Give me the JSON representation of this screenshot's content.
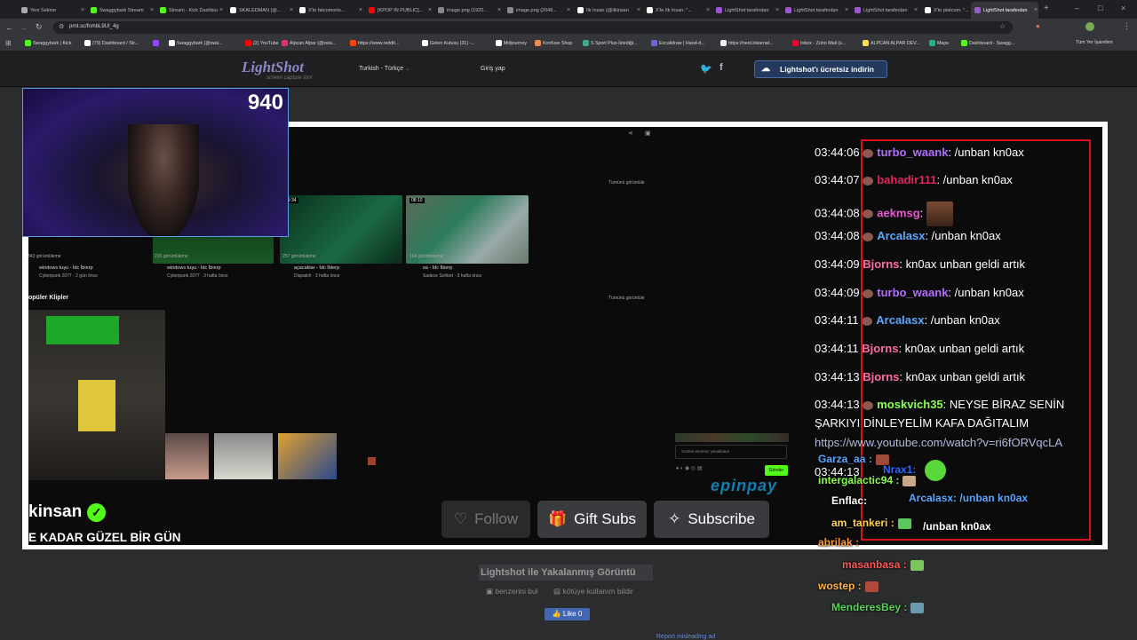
{
  "browser": {
    "tabs": [
      {
        "label": "Yeni Sekme",
        "color": "#aaaaaa"
      },
      {
        "label": "Swaggybark Stream",
        "color": "#53fc18"
      },
      {
        "label": "Stream - Kick Dashboard",
        "color": "#53fc18"
      },
      {
        "label": "SKALEDMAN (@...",
        "color": "#ffffff"
      },
      {
        "label": "X'te fatcomorto...",
        "color": "#ffffff"
      },
      {
        "label": "[KPOP IN PUBLIC]...",
        "color": "#ff0000"
      },
      {
        "label": "image.png (1920...",
        "color": "#888888"
      },
      {
        "label": "image.png (2048...",
        "color": "#888888"
      },
      {
        "label": "İlk İnsan (@ilkinsan",
        "color": "#ffffff"
      },
      {
        "label": "X'te İlk İnsan: \"...",
        "color": "#ffffff"
      },
      {
        "label": "LightShot tarafından",
        "color": "#9b59d0"
      },
      {
        "label": "LightShot tarafından",
        "color": "#9b59d0"
      },
      {
        "label": "LightShot tarafından",
        "color": "#9b59d0"
      },
      {
        "label": "X'te platcom: \"...",
        "color": "#ffffff"
      },
      {
        "label": "LightShot tarafından",
        "color": "#9b59d0"
      }
    ],
    "url": "prnt.sc/fnmbL9UI_4g",
    "bookmarks": [
      "Swaggybark | Kick",
      "(79) Dashboard / Str...",
      "",
      "Swaggybark (@swa...",
      "(2) YouTube",
      "Alpcan Alpar (@swa...",
      "https://www.reddit...",
      "Gelen Kutusu (31) -...",
      "Midjourney",
      "Konfuse Shop",
      "S Sport Plus-İstediği...",
      "Excalidraw | Hand-d...",
      "https://next.inkarnat...",
      "Inbox - Zoho Mail (s...",
      "ALPCAN ALPAR DEV...",
      "Maps",
      "Dashboard - Swagg..."
    ],
    "bookmarks_right": "Tüm Yer İşaretleri"
  },
  "lightshot": {
    "logo": "LightShot",
    "logo_sub": "screen capture tool",
    "language": "Turkish - Türkçe",
    "login": "Giriş yap",
    "download_button": "Lightshot'ı ücretsiz indirin",
    "caption": "Lightshot ile Yakalanmış Görüntü",
    "similar": "benzerini bul",
    "report": "kötüye kullanım bildir",
    "like": "Like 0",
    "misleading": "Report misleading ad"
  },
  "webcam": {
    "viewer_count": "940"
  },
  "screenshot": {
    "see_all_1": "Tümünü görüntüle",
    "see_all_2": "Tümünü görüntüle",
    "popular_clips": "opüler Klipler",
    "videos": [
      {
        "views": "343 görüntüleme",
        "title": "windows tuşu - İdc İbierp",
        "meta": "Cyberpunk 2077 · 2 gün önce"
      },
      {
        "views": "215 görüntüleme",
        "title": "windows tuşu - İdc İbierp",
        "meta": "Cyberpunk 2077 · 3 hafta önce"
      },
      {
        "views": "257 görüntüleme",
        "title": "açacaklar - İdc İbierp",
        "meta": "Dispatch · 3 hafta önce"
      },
      {
        "views": "164 görüntüleme",
        "title": "sa - İdc İbierp",
        "meta": "Sadece Sohbet · 3 hafta önce"
      }
    ],
    "thumb_duration_3": "29:34",
    "thumb_duration_4": "08:10",
    "channel_name": "kinsan",
    "stream_title": "E KADAR GÜZEL BİR GÜN",
    "follow": "Follow",
    "gift_subs": "Gift Subs",
    "subscribe": "Subscribe",
    "chat_placeholder": "Sohbet etmeniz yasaklandı",
    "sponsor": "epinpay",
    "sponsor_button": "Gönder"
  },
  "chat_messages": [
    {
      "time": "03:44:06",
      "user": "turbo_waank",
      "color": "#b36cff",
      "text": ": /unban kn0ax"
    },
    {
      "time": "03:44:07",
      "user": "bahadir111",
      "color": "#e0245e",
      "text": ": /unban kn0ax"
    },
    {
      "time": "03:44:08",
      "user": "aekmsg",
      "color": "#e85ad0",
      "text": ":"
    },
    {
      "time": "03:44:08",
      "user": "Arcalasx",
      "color": "#5aa8ff",
      "text": ": /unban kn0ax"
    },
    {
      "time": "03:44:09",
      "user": "Bjorns",
      "color": "#ff6ba8",
      "text": ": kn0ax unban geldi artık"
    },
    {
      "time": "03:44:09",
      "user": "turbo_waank",
      "color": "#b36cff",
      "text": ": /unban kn0ax"
    },
    {
      "time": "03:44:11",
      "user": "Arcalasx",
      "color": "#5aa8ff",
      "text": ": /unban kn0ax"
    },
    {
      "time": "03:44:11",
      "user": "Bjorns",
      "color": "#ff6ba8",
      "text": ": kn0ax unban geldi artık"
    },
    {
      "time": "03:44:13",
      "user": "Bjorns",
      "color": "#ff6ba8",
      "text": ": kn0ax unban geldi artık"
    },
    {
      "time": "03:44:13",
      "user": "moskvich35",
      "color": "#8aff4a",
      "text": ": NEYSE BİRAZ SENİN"
    }
  ],
  "chat_continuation": "ŞARKIYI DİNLEYELİM KAFA DAĞITALIM",
  "chat_link": "https://www.youtube.com/watch?v=ri6fORVqcLA",
  "overlay_time": "03:44:13",
  "overlay_users": [
    {
      "name": "Garza_aa :",
      "color": "#5aa8ff"
    },
    {
      "name": "Nrax1:",
      "color": "#2b6bff"
    },
    {
      "name": "intergalactic94 :",
      "color": "#8aff4a"
    },
    {
      "name": "Enflac:",
      "color": "#ffffff"
    },
    {
      "name": "Arcalasx: /unban kn0ax",
      "color": "#5aa8ff"
    },
    {
      "name": "am_tankeri :",
      "color": "#ffd24a"
    },
    {
      "name": "/unban kn0ax",
      "color": "#ffffff"
    },
    {
      "name": "abrilak :",
      "color": "#ff9a3c"
    },
    {
      "name": "masanbasa :",
      "color": "#ff5a5a"
    },
    {
      "name": "wostep :",
      "color": "#ffb347"
    },
    {
      "name": "MenderesBey :",
      "color": "#5bd45b"
    }
  ]
}
